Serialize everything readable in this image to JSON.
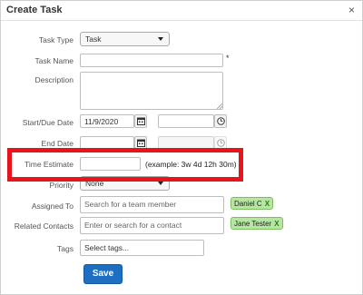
{
  "dialog": {
    "title": "Create Task",
    "close_glyph": "×"
  },
  "fields": {
    "task_type": {
      "label": "Task Type",
      "value": "Task"
    },
    "task_name": {
      "label": "Task Name",
      "value": "",
      "required_marker": "*"
    },
    "description": {
      "label": "Description",
      "value": ""
    },
    "start_due_date": {
      "label": "Start/Due Date",
      "date_value": "11/9/2020",
      "time_value": "",
      "calendar_icon": "calendar-icon",
      "clock_icon": "clock-icon"
    },
    "end_date": {
      "label": "End Date",
      "date_value": "",
      "time_value": "",
      "calendar_icon": "calendar-icon",
      "clock_icon": "clock-icon"
    },
    "time_estimate": {
      "label": "Time Estimate",
      "value": "",
      "hint": "(example: 3w 4d 12h 30m)"
    },
    "priority": {
      "label": "Priority",
      "value": "None"
    },
    "assigned_to": {
      "label": "Assigned To",
      "placeholder": "Search for a team member",
      "tag": "Daniel C",
      "tag_remove": "X"
    },
    "related_contacts": {
      "label": "Related Contacts",
      "placeholder": "Enter or search for a contact",
      "tag": "Jane Tester",
      "tag_remove": "X"
    },
    "tags": {
      "label": "Tags",
      "placeholder": "Select tags..."
    }
  },
  "actions": {
    "save_label": "Save"
  },
  "colors": {
    "highlight": "#e8141b",
    "primary_button": "#1e6fc2",
    "tag_background": "#b7e6a2"
  }
}
